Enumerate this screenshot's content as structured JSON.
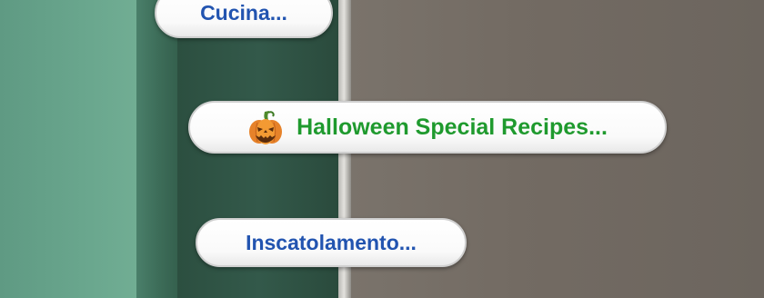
{
  "pie_menu": {
    "options": [
      {
        "label": "Cucina...",
        "color": "#2254b0"
      },
      {
        "label": "Halloween Special Recipes...",
        "color": "#1f9a2e",
        "icon": "pumpkin-icon"
      },
      {
        "label": "Inscatolamento...",
        "color": "#2254b0"
      }
    ]
  }
}
